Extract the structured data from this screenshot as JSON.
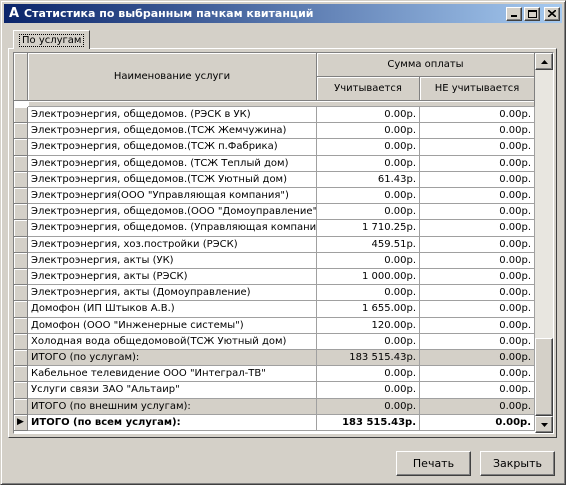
{
  "window": {
    "title": "Статистика по выбранным пачкам квитанций",
    "controls": [
      "_",
      "□",
      "✕"
    ]
  },
  "tabs": [
    {
      "label": "По услугам",
      "active": true
    }
  ],
  "grid": {
    "headers": {
      "service": "Наименование услуги",
      "group": "Сумма оплаты",
      "counted": "Учитывается",
      "not_counted": "НЕ учитывается"
    },
    "rows": [
      {
        "name": "Электроэнергия, общедомов. (РЭСК  в УК)",
        "counted": "0.00р.",
        "not_counted": "0.00р.",
        "type": "normal"
      },
      {
        "name": "Электроэнергия, общедомов.(ТСЖ Жемчужина)",
        "counted": "0.00р.",
        "not_counted": "0.00р.",
        "type": "normal"
      },
      {
        "name": "Электроэнергия, общедомов.(ТСЖ п.Фабрика)",
        "counted": "0.00р.",
        "not_counted": "0.00р.",
        "type": "normal"
      },
      {
        "name": "Электроэнергия, общедомов. (ТСЖ Теплый дом)",
        "counted": "0.00р.",
        "not_counted": "0.00р.",
        "type": "normal"
      },
      {
        "name": "Электроэнергия, общедомов.(ТСЖ Уютный дом)",
        "counted": "61.43р.",
        "not_counted": "0.00р.",
        "type": "normal"
      },
      {
        "name": "Электроэнергия(ООО \"Управляющая компания\")",
        "counted": "0.00р.",
        "not_counted": "0.00р.",
        "type": "normal"
      },
      {
        "name": "Электроэнергия, общедомов.(ООО \"Домоуправление\")",
        "counted": "0.00р.",
        "not_counted": "0.00р.",
        "type": "normal"
      },
      {
        "name": "Электроэнергия, общедомов. (Управляющая компания",
        "counted": "1 710.25р.",
        "not_counted": "0.00р.",
        "type": "normal"
      },
      {
        "name": "Электроэнергия, хоз.постройки (РЭСК)",
        "counted": "459.51р.",
        "not_counted": "0.00р.",
        "type": "normal"
      },
      {
        "name": "Электроэнергия, акты (УК)",
        "counted": "0.00р.",
        "not_counted": "0.00р.",
        "type": "normal"
      },
      {
        "name": "Электроэнергия, акты (РЭСК)",
        "counted": "1 000.00р.",
        "not_counted": "0.00р.",
        "type": "normal"
      },
      {
        "name": "Электроэнергия, акты (Домоуправление)",
        "counted": "0.00р.",
        "not_counted": "0.00р.",
        "type": "normal"
      },
      {
        "name": "Домофон (ИП Штыков А.В.)",
        "counted": "1 655.00р.",
        "not_counted": "0.00р.",
        "type": "normal"
      },
      {
        "name": "Домофон (ООО \"Инженерные системы\")",
        "counted": "120.00р.",
        "not_counted": "0.00р.",
        "type": "normal"
      },
      {
        "name": "Холодная вода общедомовой(ТСЖ Уютный дом)",
        "counted": "0.00р.",
        "not_counted": "0.00р.",
        "type": "normal"
      },
      {
        "name": "ИТОГО (по услугам):",
        "counted": "183 515.43р.",
        "not_counted": "0.00р.",
        "type": "sub"
      },
      {
        "name": "Кабельное телевидение ООО \"Интеграл-ТВ\"",
        "counted": "0.00р.",
        "not_counted": "0.00р.",
        "type": "normal"
      },
      {
        "name": "Услуги связи ЗАО \"Альтаир\"",
        "counted": "0.00р.",
        "not_counted": "0.00р.",
        "type": "normal"
      },
      {
        "name": "ИТОГО (по внешним услугам):",
        "counted": "0.00р.",
        "not_counted": "0.00р.",
        "type": "sub"
      },
      {
        "name": "ИТОГО (по всем услугам):",
        "counted": "183 515.43р.",
        "not_counted": "0.00р.",
        "type": "total",
        "current": true
      }
    ]
  },
  "buttons": {
    "print": "Печать",
    "close": "Закрыть"
  }
}
